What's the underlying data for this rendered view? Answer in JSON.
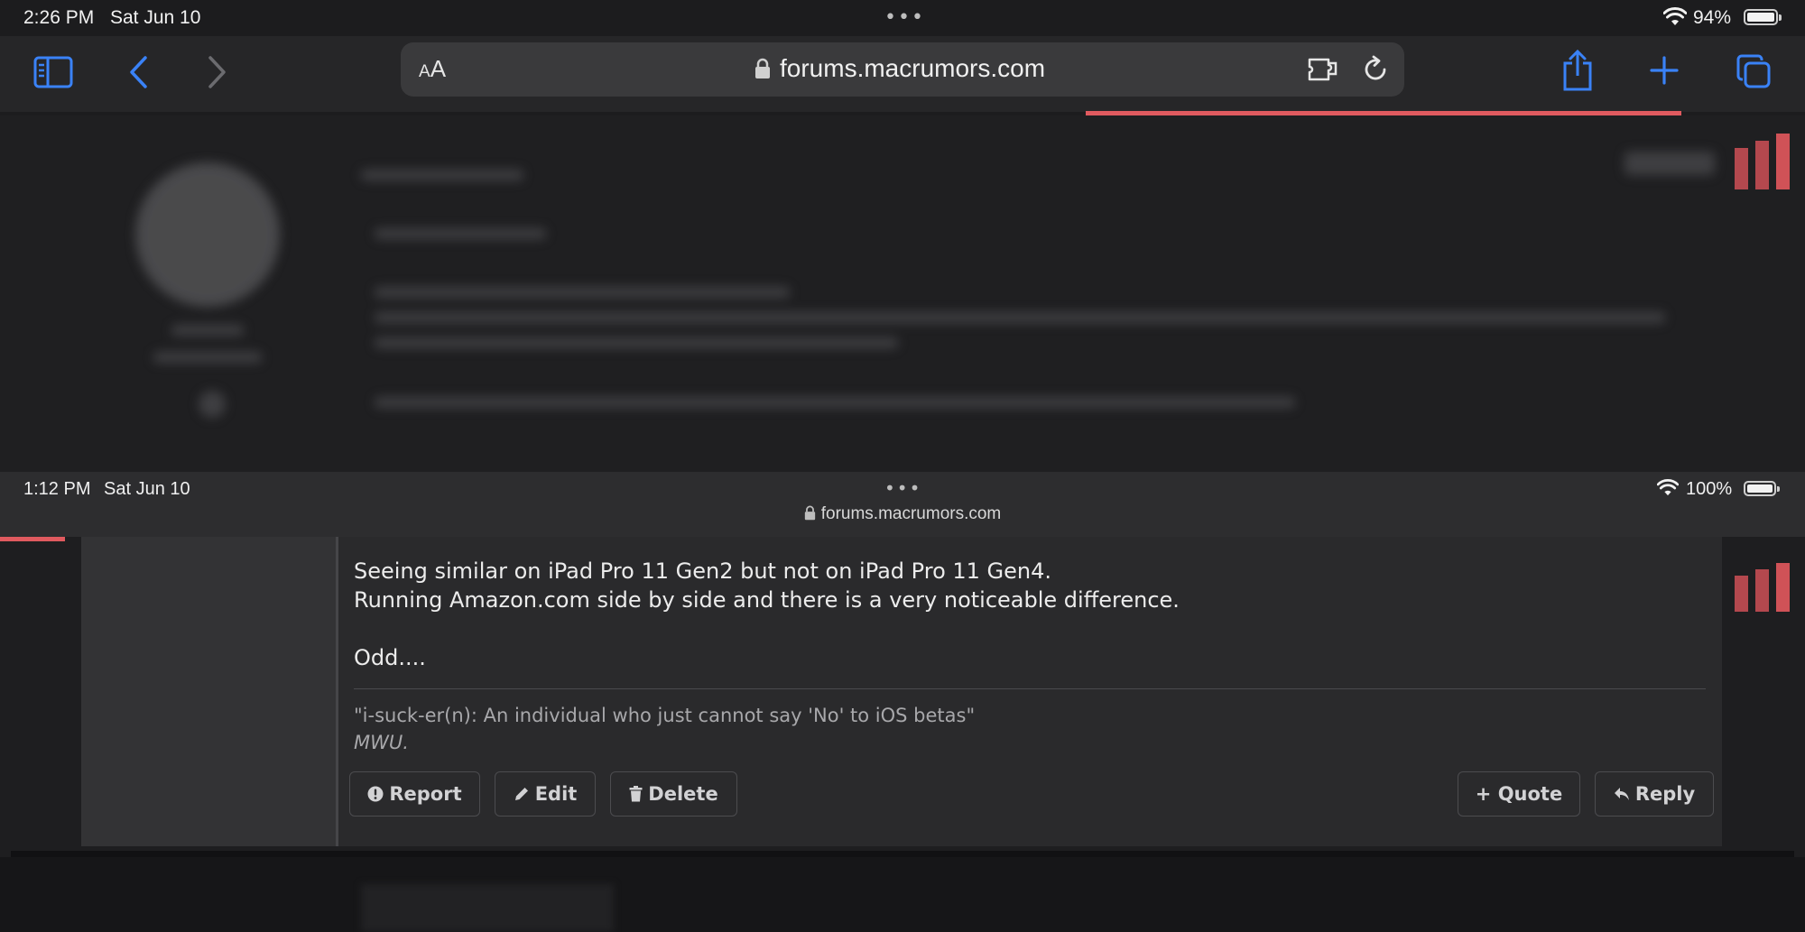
{
  "outer": {
    "status": {
      "time": "2:26 PM",
      "date": "Sat Jun 10",
      "battery_pct": "94%",
      "battery_level": 0.94
    },
    "toolbar": {
      "aa_label_small": "A",
      "aa_label_big": "A",
      "url": "forums.macrumors.com",
      "icons": [
        "sidebar-icon",
        "back-icon",
        "forward-icon",
        "lock-icon",
        "extension-icon",
        "reload-icon",
        "share-icon",
        "new-tab-icon",
        "tabs-icon"
      ]
    }
  },
  "inner": {
    "status": {
      "time": "1:12 PM",
      "date": "Sat Jun 10",
      "battery_pct": "100%",
      "battery_level": 1.0,
      "url": "forums.macrumors.com"
    },
    "post": {
      "lines": [
        "Seeing similar on iPad Pro 11 Gen2 but not on iPad Pro 11 Gen4.",
        "Running Amazon.com side by side and there is a very noticeable difference.",
        "Odd...."
      ],
      "signature": {
        "line1": "\"i-suck-er(n): An individual who just cannot say 'No' to iOS betas\"",
        "line2": "MWU."
      },
      "actions": {
        "report": "Report",
        "edit": "Edit",
        "delete": "Delete",
        "quote": "+ Quote",
        "reply": "Reply"
      }
    }
  },
  "colors": {
    "accent": "#3478f6",
    "progress": "#e05a5f",
    "background": "#1c1c1e"
  }
}
